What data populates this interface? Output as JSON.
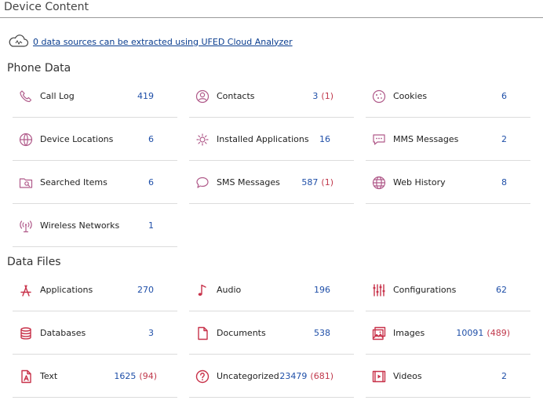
{
  "header": {
    "title": "Device Content"
  },
  "cloud": {
    "link": "0 data sources can be extracted using UFED Cloud Analyzer"
  },
  "phone_data": {
    "title": "Phone Data",
    "items": [
      {
        "label": "Call Log",
        "count": "419",
        "deleted": ""
      },
      {
        "label": "Contacts",
        "count": "3",
        "deleted": "(1)"
      },
      {
        "label": "Cookies",
        "count": "6",
        "deleted": ""
      },
      {
        "label": "Device Locations",
        "count": "6",
        "deleted": ""
      },
      {
        "label": "Installed Applications",
        "count": "16",
        "deleted": ""
      },
      {
        "label": "MMS Messages",
        "count": "2",
        "deleted": ""
      },
      {
        "label": "Searched Items",
        "count": "6",
        "deleted": ""
      },
      {
        "label": "SMS Messages",
        "count": "587",
        "deleted": "(1)"
      },
      {
        "label": "Web History",
        "count": "8",
        "deleted": ""
      },
      {
        "label": "Wireless Networks",
        "count": "1",
        "deleted": ""
      }
    ]
  },
  "data_files": {
    "title": "Data Files",
    "items": [
      {
        "label": "Applications",
        "count": "270",
        "deleted": ""
      },
      {
        "label": "Audio",
        "count": "196",
        "deleted": ""
      },
      {
        "label": "Configurations",
        "count": "62",
        "deleted": ""
      },
      {
        "label": "Databases",
        "count": "3",
        "deleted": ""
      },
      {
        "label": "Documents",
        "count": "538",
        "deleted": ""
      },
      {
        "label": "Images",
        "count": "10091",
        "deleted": "(489)"
      },
      {
        "label": "Text",
        "count": "1625",
        "deleted": "(94)"
      },
      {
        "label": "Uncategorized",
        "count": "23479",
        "deleted": "(681)"
      },
      {
        "label": "Videos",
        "count": "2",
        "deleted": ""
      }
    ]
  },
  "icons": {
    "phone_data": [
      "phone-icon",
      "contact-icon",
      "cookie-icon",
      "location-icon",
      "installed-app-icon",
      "mms-icon",
      "search-folder-icon",
      "sms-icon",
      "globe-icon",
      "wireless-icon"
    ],
    "data_files": [
      "applications-icon",
      "audio-icon",
      "configurations-icon",
      "database-icon",
      "document-icon",
      "image-icon",
      "text-icon",
      "uncategorized-icon",
      "video-icon"
    ]
  },
  "colors": {
    "count": "#1f4fa8",
    "deleted": "#c0384b",
    "phone_icon": "#b05a8a",
    "file_icon": "#c8324a",
    "link": "#0a3d8f"
  }
}
